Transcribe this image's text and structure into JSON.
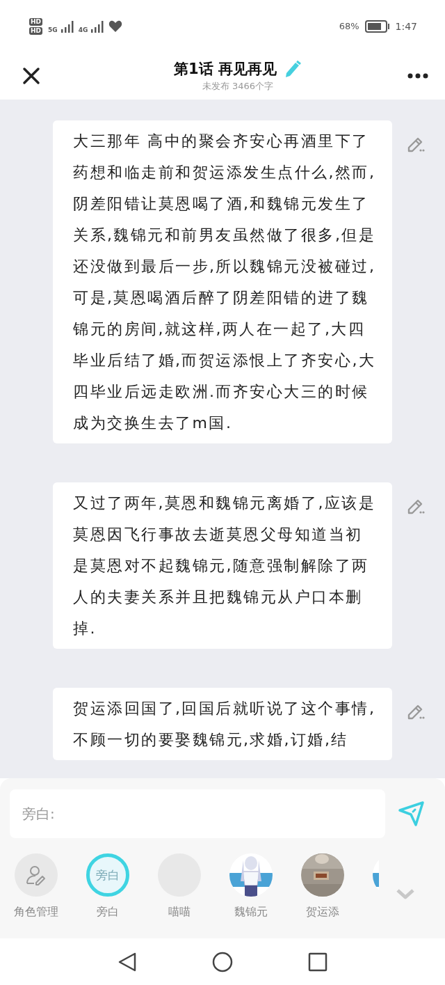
{
  "status_bar": {
    "sim_labels": [
      "HD",
      "HD"
    ],
    "network_labels": [
      "5G",
      "4G"
    ],
    "battery": "68%",
    "time": "1:47"
  },
  "header": {
    "title": "第1话 再见再见",
    "subtitle": "未发布 3466个字"
  },
  "paragraphs": [
    {
      "text": "大三那年 高中的聚会齐安心再酒里下了药想和临走前和贺运添发生点什么,然而,阴差阳错让莫恩喝了酒,和魏锦元发生了关系,魏锦元和前男友虽然做了很多,但是还没做到最后一步,所以魏锦元没被碰过,可是,莫恩喝酒后醉了阴差阳错的进了魏锦元的房间,就这样,两人在一起了,大四毕业后结了婚,而贺运添恨上了齐安心,大四毕业后远走欧洲.而齐安心大三的时候成为交换生去了m国."
    },
    {
      "text": "又过了两年,莫恩和魏锦元离婚了,应该是莫恩因飞行事故去逝莫恩父母知道当初是莫恩对不起魏锦元,随意强制解除了两人的夫妻关系并且把魏锦元从户口本删掉."
    },
    {
      "text": "贺运添回国了,回国后就听说了这个事情,不顾一切的要娶魏锦元,求婚,订婚,结"
    }
  ],
  "input": {
    "placeholder": "旁白:"
  },
  "roles": [
    {
      "kind": "manage",
      "label": "角色管理",
      "selected": false
    },
    {
      "kind": "text",
      "avatar_text": "旁白",
      "label": "旁白",
      "selected": true
    },
    {
      "kind": "blank",
      "label": "喵喵",
      "selected": false
    },
    {
      "kind": "picture",
      "label": "魏锦元",
      "selected": false
    },
    {
      "kind": "picture",
      "label": "贺运添",
      "selected": false
    },
    {
      "kind": "picture",
      "selected": false
    }
  ]
}
